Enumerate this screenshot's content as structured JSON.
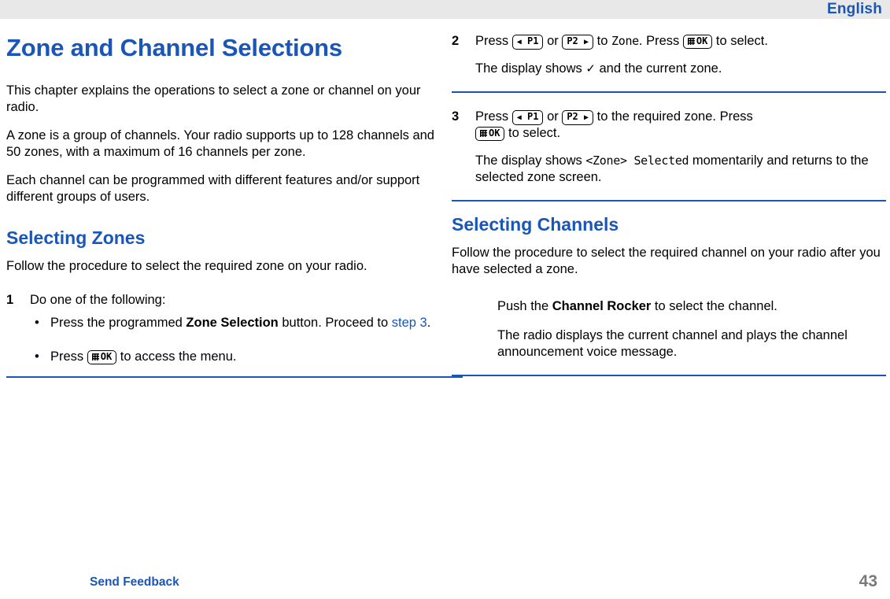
{
  "header": {
    "language_label": "English"
  },
  "left_column": {
    "title": "Zone and Channel Selections",
    "intro_1": "This chapter explains the operations to select a zone or channel on your radio.",
    "intro_2": "A zone is a group of channels. Your radio supports up to 128 channels and 50 zones, with a maximum of 16 channels per zone.",
    "intro_3": "Each channel can be programmed with different features and/or support different groups of users.",
    "section_heading": "Selecting Zones",
    "section_intro": "Follow the procedure to select the required zone on your radio.",
    "step1": {
      "number": "1",
      "text": "Do one of the following:",
      "bullets": [
        {
          "marker": "•",
          "text_before": "Press the programmed ",
          "bold": "Zone Selection",
          "text_after": " button. Proceed to ",
          "link": "step 3",
          "text_end": "."
        },
        {
          "marker": "•",
          "text_before": "Press ",
          "key": "OK",
          "text_after": " to access the menu."
        }
      ]
    }
  },
  "right_column": {
    "step2": {
      "number": "2",
      "text_a": "Press ",
      "key_p1": "P1",
      "text_b": " or ",
      "key_p2": "P2",
      "text_c": " to ",
      "mono_zone": "Zone",
      "text_d": ". Press ",
      "key_ok": "OK",
      "text_e": " to select.",
      "result": "The display shows ✓ and the current zone.",
      "result_before": "The display shows ",
      "result_check": "✓",
      "result_after": " and the current zone."
    },
    "step3": {
      "number": "3",
      "text_a": "Press ",
      "key_p1": "P1",
      "text_b": " or ",
      "key_p2": "P2",
      "text_c": " to the required zone. Press ",
      "key_ok": "OK",
      "text_d": " to select.",
      "result_before": "The display shows ",
      "result_mono": "<Zone> Selected",
      "result_after": " momentarily and returns to the selected zone screen."
    },
    "section_heading": "Selecting Channels",
    "section_intro": "Follow the procedure to select the required channel on your radio after you have selected a zone.",
    "instruction_before": "Push the ",
    "instruction_bold": "Channel Rocker",
    "instruction_after": " to select the channel.",
    "result": "The radio displays the current channel and plays the channel announcement voice message."
  },
  "footer": {
    "feedback_label": "Send Feedback",
    "page_number": "43"
  },
  "colors": {
    "accent": "#1a56b8",
    "topbar": "#e8e8e8",
    "page_number": "#7a7a7a"
  }
}
